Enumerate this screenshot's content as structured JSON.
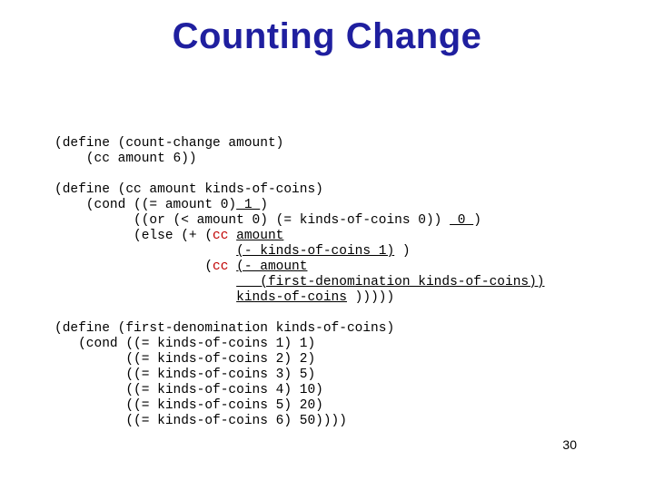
{
  "title": "Counting Change",
  "pagenum": "30",
  "code": {
    "l1": "(define (count-change amount)",
    "l2": "    (cc amount 6))",
    "l3": "",
    "l4": "(define (cc amount kinds-of-coins)",
    "l5a": "    (cond ((= amount 0)",
    "l5b": " 1 ",
    "l5c": ")",
    "l6a": "          ((or (< amount 0) (= kinds-of-coins 0)) ",
    "l6b": " 0 ",
    "l6c": ")",
    "l7a": "          (else (+ (",
    "cc1": "cc",
    "l7b": " ",
    "u7": "amount",
    "l8a": "                       ",
    "u8": "(- kinds-of-coins 1)",
    "l8b": " )",
    "l9a": "                   (",
    "cc2": "cc",
    "l9b": " ",
    "u9": "(- amount",
    "l10a": "                       ",
    "u10": "   (first-denomination kinds-of-coins))",
    "l11a": "                       ",
    "u11": "kinds-of-coins",
    "l11b": " )))))",
    "l12": "",
    "l13": "(define (first-denomination kinds-of-coins)",
    "l14": "   (cond ((= kinds-of-coins 1) 1)",
    "l15": "         ((= kinds-of-coins 2) 2)",
    "l16": "         ((= kinds-of-coins 3) 5)",
    "l17": "         ((= kinds-of-coins 4) 10)",
    "l18": "         ((= kinds-of-coins 5) 20)",
    "l19": "         ((= kinds-of-coins 6) 50))))"
  }
}
